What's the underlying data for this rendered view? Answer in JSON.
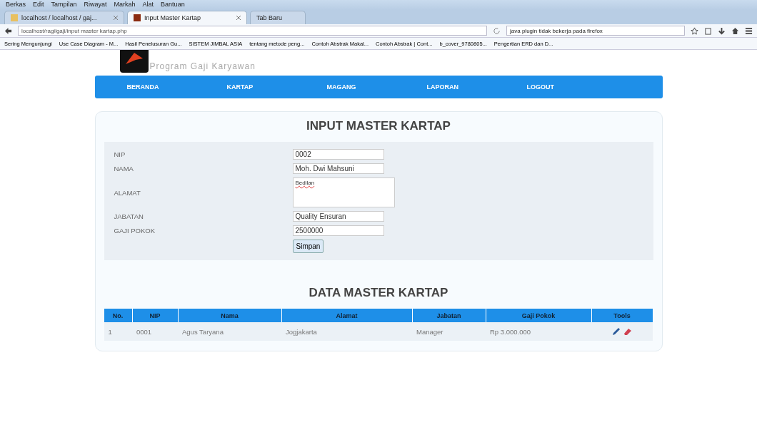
{
  "browser": {
    "menu": [
      "Berkas",
      "Edit",
      "Tampilan",
      "Riwayat",
      "Markah",
      "Alat",
      "Bantuan"
    ],
    "tabs": [
      {
        "title": "localhost / localhost / gaj...",
        "selected": false
      },
      {
        "title": "Input Master Kartap",
        "selected": true
      },
      {
        "title": "Tab Baru",
        "selected": false
      }
    ],
    "address": "localhost/ragilgaji/input master kartap.php",
    "search": "java plugin tidak bekerja pada firefox",
    "bookmarks": [
      "Sering Mengunjungi",
      "Use Case Diagram - M...",
      "Hasil Penelusuran Gu...",
      "SISTEM JIMBAL ASIA",
      "tentang metode peng...",
      "Contoh Abstrak Makal...",
      "Contoh Abstrak | Cont...",
      "b_cover_9780805...",
      "Pengertian ERD dan D..."
    ]
  },
  "header": {
    "subtitle": "Program Gaji Karyawan"
  },
  "nav": [
    "BERANDA",
    "KARTAP",
    "MAGANG",
    "LAPORAN",
    "LOGOUT"
  ],
  "form": {
    "title": "INPUT MASTER KARTAP",
    "fields": [
      {
        "label": "NIP",
        "value": "0002",
        "kind": "text"
      },
      {
        "label": "NAMA",
        "value": "Moh. Dwi Mahsuni",
        "kind": "text"
      },
      {
        "label": "ALAMAT",
        "value": "Bedilan",
        "kind": "textarea"
      },
      {
        "label": "JABATAN",
        "value": "Quality Ensuran",
        "kind": "text"
      },
      {
        "label": "GAJI POKOK",
        "value": "2500000",
        "kind": "text"
      }
    ],
    "submit": "Simpan"
  },
  "table": {
    "title": "DATA MASTER KARTAP",
    "columns": [
      "No.",
      "NIP",
      "Nama",
      "Alamat",
      "Jabatan",
      "Gaji Pokok",
      "Tools"
    ],
    "rows": [
      {
        "cells": [
          "1",
          "0001",
          "Agus Taryana",
          "Jogjakarta",
          "Manager",
          "Rp 3.000.000"
        ]
      }
    ]
  }
}
